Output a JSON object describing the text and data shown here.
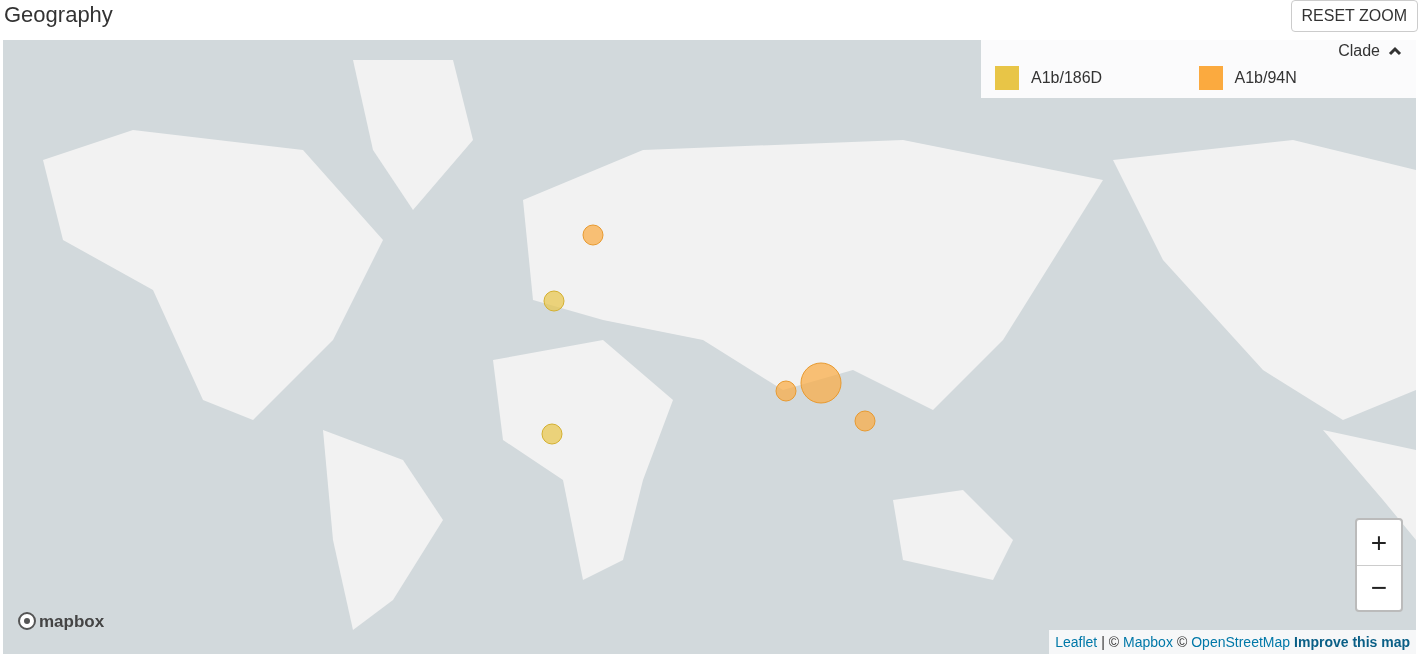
{
  "title": "Geography",
  "reset_button": "RESET ZOOM",
  "legend": {
    "title": "Clade",
    "expanded": true,
    "items": [
      {
        "label": "A1b/186D",
        "color": "#e8c547"
      },
      {
        "label": "A1b/94N",
        "color": "#fbaa3f"
      }
    ]
  },
  "zoom": {
    "in": "+",
    "out": "−"
  },
  "logo": "mapbox",
  "attribution": {
    "leaflet": "Leaflet",
    "separator": "| ©",
    "mapbox": "Mapbox",
    "copy": "©",
    "osm": "OpenStreetMap",
    "improve": "Improve this map"
  }
}
